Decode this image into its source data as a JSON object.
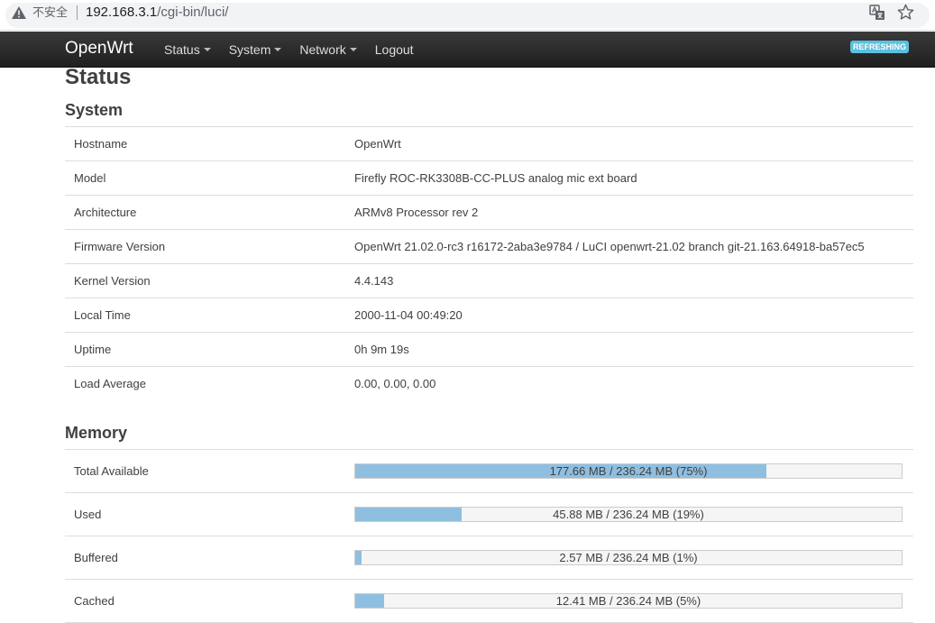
{
  "browser": {
    "security_label": "不安全",
    "url_host": "192.168.3.1",
    "url_path": "/cgi-bin/luci/"
  },
  "navbar": {
    "brand": "OpenWrt",
    "menu": [
      {
        "label": "Status",
        "dropdown": true
      },
      {
        "label": "System",
        "dropdown": true
      },
      {
        "label": "Network",
        "dropdown": true
      },
      {
        "label": "Logout",
        "dropdown": false
      }
    ],
    "refresh_badge": "REFRESHING",
    "badge_color": "#5bc0de"
  },
  "page": {
    "title": "Status"
  },
  "system": {
    "title": "System",
    "rows": [
      {
        "label": "Hostname",
        "value": "OpenWrt"
      },
      {
        "label": "Model",
        "value": "Firefly ROC-RK3308B-CC-PLUS analog mic ext board"
      },
      {
        "label": "Architecture",
        "value": "ARMv8 Processor rev 2"
      },
      {
        "label": "Firmware Version",
        "value": "OpenWrt 21.02.0-rc3 r16172-2aba3e9784 / LuCI openwrt-21.02 branch git-21.163.64918-ba57ec5"
      },
      {
        "label": "Kernel Version",
        "value": "4.4.143"
      },
      {
        "label": "Local Time",
        "value": "2000-11-04 00:49:20"
      },
      {
        "label": "Uptime",
        "value": "0h 9m 19s"
      },
      {
        "label": "Load Average",
        "value": "0.00, 0.00, 0.00"
      }
    ]
  },
  "memory": {
    "title": "Memory",
    "bar_color": "#8fbfe0",
    "rows": [
      {
        "label": "Total Available",
        "text": "177.66 MB / 236.24 MB (75%)",
        "fraction": 0.752
      },
      {
        "label": "Used",
        "text": "45.88 MB / 236.24 MB (19%)",
        "fraction": 0.194
      },
      {
        "label": "Buffered",
        "text": "2.57 MB / 236.24 MB (1%)",
        "fraction": 0.011
      },
      {
        "label": "Cached",
        "text": "12.41 MB / 236.24 MB (5%)",
        "fraction": 0.053
      }
    ]
  }
}
